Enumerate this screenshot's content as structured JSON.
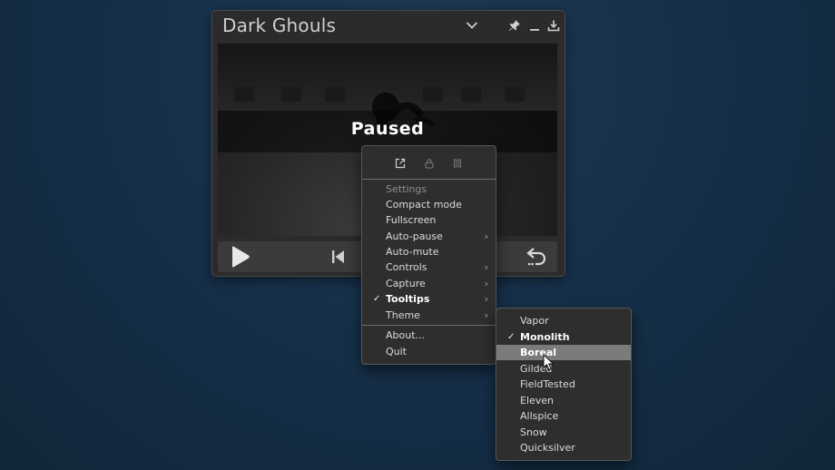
{
  "window": {
    "title": "Dark Ghouls"
  },
  "titlebar": {
    "icons": [
      "chevron-down-icon",
      "pin-icon",
      "minimize-icon",
      "download-icon"
    ]
  },
  "video": {
    "status": "Paused"
  },
  "controls": {
    "icons": [
      "play-icon",
      "skip-back-icon",
      "replay-icon"
    ]
  },
  "menu": {
    "toolbar_icons": [
      "open-external-icon",
      "lock-icon",
      "pause-icon"
    ],
    "items": [
      {
        "label": "Settings",
        "disabled": true
      },
      {
        "label": "Compact mode"
      },
      {
        "label": "Fullscreen"
      },
      {
        "label": "Auto-pause",
        "submenu": true
      },
      {
        "label": "Auto-mute"
      },
      {
        "label": "Controls",
        "submenu": true
      },
      {
        "label": "Capture",
        "submenu": true
      },
      {
        "label": "Tooltips",
        "checked": true,
        "submenu": true
      },
      {
        "label": "Theme",
        "submenu": true
      },
      {
        "label": "About..."
      },
      {
        "label": "Quit"
      }
    ]
  },
  "theme_menu": {
    "items": [
      {
        "label": "Vapor"
      },
      {
        "label": "Monolith",
        "checked": true
      },
      {
        "label": "Boreal",
        "highlighted": true
      },
      {
        "label": "Gilded"
      },
      {
        "label": "FieldTested"
      },
      {
        "label": "Eleven"
      },
      {
        "label": "Allspice"
      },
      {
        "label": "Snow"
      },
      {
        "label": "Quicksilver"
      }
    ]
  },
  "glyphs": {
    "check": "✓",
    "arrow": "›"
  },
  "colors": {
    "desktop": "#16304a",
    "window": "#2b2b2b",
    "menu": "#2e2e2e",
    "highlight": "#7b7b7b"
  }
}
